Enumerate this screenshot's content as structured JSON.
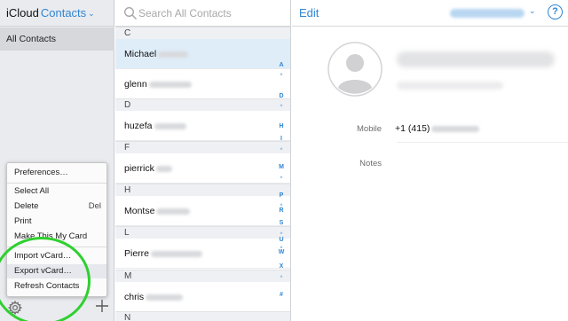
{
  "header": {
    "app_name": "iCloud",
    "app_section": "Contacts",
    "section_chevron": "⌄"
  },
  "sidebar": {
    "groups": [
      {
        "label": "All Contacts",
        "selected": true
      }
    ],
    "gear_icon": "gear-icon",
    "add_icon": "plus-icon"
  },
  "menu": {
    "items": [
      {
        "label": "Preferences…",
        "shortcut": ""
      },
      {
        "label": "Select All",
        "shortcut": ""
      },
      {
        "label": "Delete",
        "shortcut": "Del"
      },
      {
        "label": "Print",
        "shortcut": ""
      },
      {
        "label": "Make This My Card",
        "shortcut": ""
      },
      {
        "label": "Import vCard…",
        "shortcut": ""
      },
      {
        "label": "Export vCard…",
        "shortcut": "",
        "highlighted": true
      },
      {
        "label": "Refresh Contacts",
        "shortcut": ""
      }
    ]
  },
  "search": {
    "placeholder": "Search All Contacts",
    "value": ""
  },
  "contact_list": {
    "sections": [
      {
        "letter": "C",
        "contacts": [
          {
            "first_name": "Michael",
            "selected": true
          },
          {
            "first_name": "glenn"
          }
        ]
      },
      {
        "letter": "D",
        "contacts": [
          {
            "first_name": "huzefa"
          }
        ]
      },
      {
        "letter": "F",
        "contacts": [
          {
            "first_name": "pierrick"
          }
        ]
      },
      {
        "letter": "H",
        "contacts": [
          {
            "first_name": "Montse"
          }
        ]
      },
      {
        "letter": "L",
        "contacts": [
          {
            "first_name": "Pierre"
          }
        ]
      },
      {
        "letter": "M",
        "contacts": [
          {
            "first_name": "chris"
          }
        ]
      },
      {
        "letter": "N",
        "contacts": []
      }
    ],
    "index": [
      "A",
      "•",
      "D",
      "•",
      "H",
      "I",
      "•",
      "M",
      "•",
      "P",
      "•",
      "R",
      "S",
      "•",
      "U",
      "•",
      "W",
      "X",
      "•",
      "#"
    ]
  },
  "detail": {
    "edit_label": "Edit",
    "help_label": "?",
    "account_chevron": "⌄",
    "fields": [
      {
        "label": "Mobile",
        "value": "+1 (415)"
      },
      {
        "label": "Notes",
        "value": ""
      }
    ]
  },
  "colors": {
    "accent": "#2f86d4",
    "sidebar_bg": "#e9ebef",
    "selected_row": "#dfedf9",
    "annotation": "#2fd02f"
  }
}
